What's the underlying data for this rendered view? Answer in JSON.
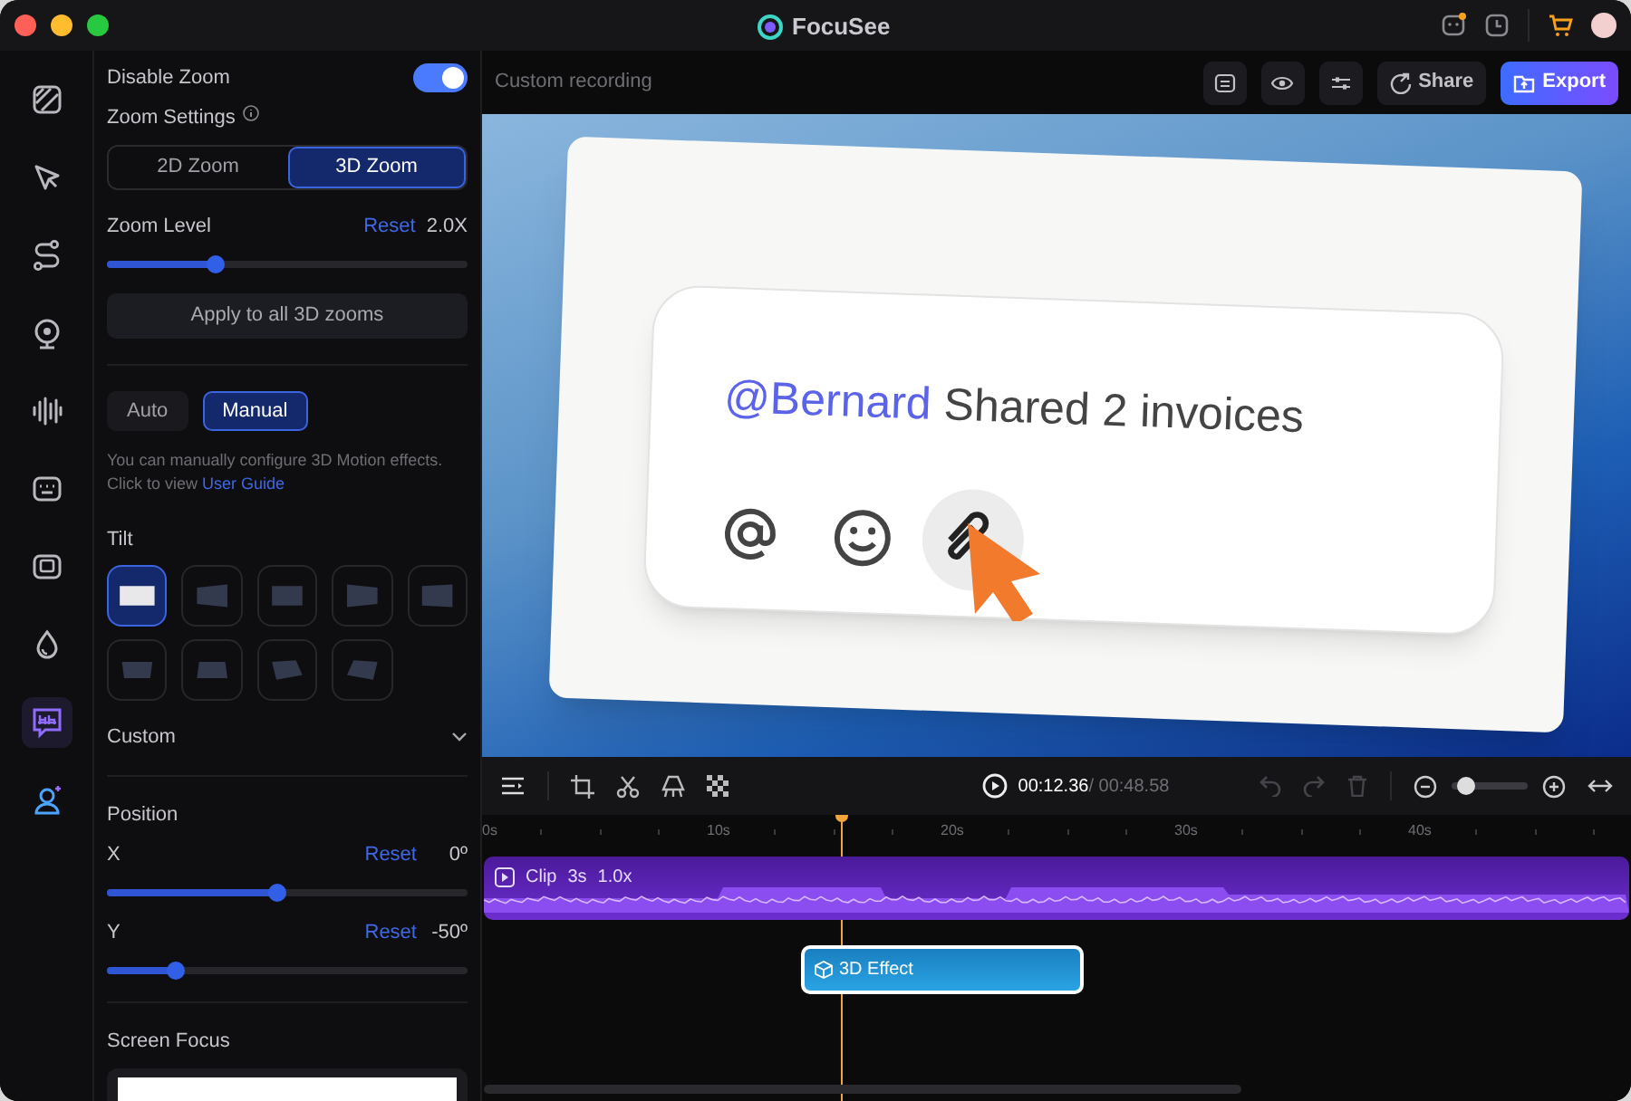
{
  "window": {
    "title": "FocuSee"
  },
  "sidebar": {
    "items": [
      {
        "kind": "background",
        "selected": false
      },
      {
        "kind": "cursor",
        "selected": false
      },
      {
        "kind": "path",
        "selected": false
      },
      {
        "kind": "webcam",
        "selected": false
      },
      {
        "kind": "audio",
        "selected": false
      },
      {
        "kind": "keyboard",
        "selected": false
      },
      {
        "kind": "caption",
        "selected": false
      },
      {
        "kind": "drop",
        "selected": false
      },
      {
        "kind": "subtitle",
        "selected": true
      },
      {
        "kind": "avatar",
        "selected": false
      }
    ]
  },
  "panel": {
    "disable_zoom": {
      "label": "Disable Zoom",
      "on": true
    },
    "zoom_settings": "Zoom Settings",
    "zoom_modes": [
      {
        "label": "2D Zoom",
        "selected": false
      },
      {
        "label": "3D Zoom",
        "selected": true
      }
    ],
    "zoom_level": {
      "label": "Zoom Level",
      "reset": "Reset",
      "value": "2.0X",
      "level": 0.3
    },
    "apply_button": "Apply to all 3D zooms",
    "motion_modes": [
      {
        "label": "Auto",
        "selected": false
      },
      {
        "label": "Manual",
        "selected": true
      }
    ],
    "help": {
      "text": "You can manually configure 3D Motion effects. Click to view",
      "link": "User Guide"
    },
    "tilt": {
      "label": "Tilt",
      "presets": [
        {
          "selected": true
        },
        {
          "selected": false
        },
        {
          "selected": false
        },
        {
          "selected": false
        },
        {
          "selected": false
        },
        {
          "selected": false
        },
        {
          "selected": false
        },
        {
          "selected": false
        },
        {
          "selected": false
        }
      ]
    },
    "custom": {
      "label": "Custom"
    },
    "position": {
      "label": "Position",
      "sliders": [
        {
          "label": "X",
          "reset": "Reset",
          "value": "0º",
          "level": 0.47
        },
        {
          "label": "Y",
          "reset": "Reset",
          "value": "-50º",
          "level": 0.19
        }
      ]
    },
    "screen_focus": {
      "label": "Screen Focus"
    }
  },
  "header": {
    "title": "Custom recording",
    "share": "Share",
    "export": "Export"
  },
  "preview": {
    "mention": "@Bernard",
    "message": "Shared 2 invoices"
  },
  "playback": {
    "current": "00:12.36",
    "total": "/ 00:48.58",
    "zoom_slider": {
      "level": 0.2
    }
  },
  "timeline": {
    "ruler": [
      "0s",
      "10s",
      "20s",
      "30s",
      "40s"
    ],
    "clip": {
      "label": "Clip",
      "duration": "3s",
      "speed": "1.0x"
    },
    "effect": {
      "label": "3D Effect"
    }
  }
}
